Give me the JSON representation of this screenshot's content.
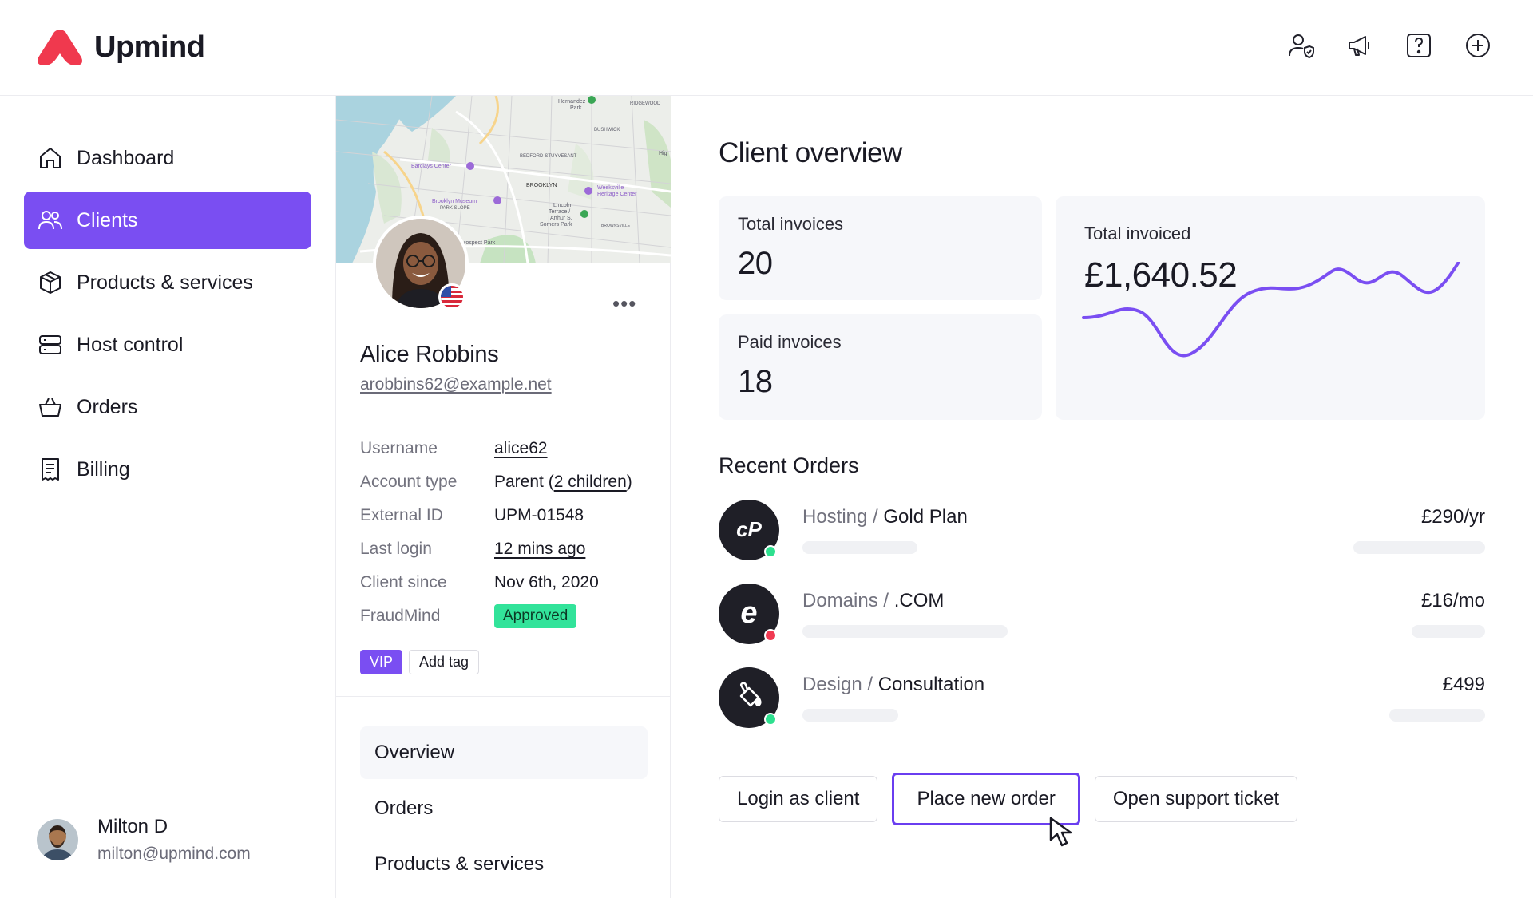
{
  "brand": {
    "name": "Upmind",
    "accent": "#7a4ef2",
    "logo_color": "#f0394e"
  },
  "header": {
    "icons": [
      "user-shield-icon",
      "megaphone-icon",
      "help-icon",
      "plus-circle-icon"
    ]
  },
  "sidebar": {
    "items": [
      {
        "label": "Dashboard",
        "icon": "home-icon",
        "active": false
      },
      {
        "label": "Clients",
        "icon": "users-icon",
        "active": true
      },
      {
        "label": "Products & services",
        "icon": "box-icon",
        "active": false
      },
      {
        "label": "Host control",
        "icon": "server-icon",
        "active": false
      },
      {
        "label": "Orders",
        "icon": "basket-icon",
        "active": false
      },
      {
        "label": "Billing",
        "icon": "receipt-icon",
        "active": false
      }
    ],
    "user": {
      "name": "Milton D",
      "email": "milton@upmind.com"
    }
  },
  "client": {
    "name": "Alice Robbins",
    "email": "arobbins62@example.net",
    "more_label": "•••",
    "details": {
      "username": {
        "label": "Username",
        "value": "alice62"
      },
      "account_type": {
        "label": "Account type",
        "value_prefix": "Parent (",
        "value_link": "2 children",
        "value_suffix": ")"
      },
      "external_id": {
        "label": "External ID",
        "value": "UPM-01548"
      },
      "last_login": {
        "label": "Last login",
        "value": "12 mins ago"
      },
      "client_since": {
        "label": "Client since",
        "value": "Nov 6th, 2020"
      },
      "fraudmind": {
        "label": "FraudMind",
        "value": "Approved"
      }
    },
    "tags": {
      "vip": "VIP",
      "add": "Add tag"
    },
    "subnav": [
      "Overview",
      "Orders",
      "Products & services"
    ],
    "map_labels": {
      "l1": "Hernandez",
      "l2": "Park",
      "l3": "RIDGEWOOD",
      "l4": "BUSHWICK",
      "l5": "BEDFORD-STUYVESANT",
      "l6": "Barclays Center",
      "l7": "BROOKLYN",
      "l8": "Weeksville",
      "l9": "Heritage Center",
      "l10": "Brooklyn Museum",
      "l11": "PARK SLOPE",
      "l12": "Lincoln",
      "l13": "Terrace /",
      "l14": "Arthur S.",
      "l15": "Somers Park",
      "l16": "BROWNSVILLE",
      "l17": "rospect Park",
      "l18": "Hig"
    }
  },
  "overview": {
    "title": "Client overview",
    "total_invoices": {
      "label": "Total invoices",
      "value": "20"
    },
    "paid_invoices": {
      "label": "Paid invoices",
      "value": "18"
    },
    "total_invoiced": {
      "label": "Total invoiced",
      "value": "£1,640.52"
    },
    "recent_orders_title": "Recent Orders",
    "orders": [
      {
        "category": "Hosting /",
        "name": "Gold Plan",
        "price": "£290/yr",
        "icon": "cpanel-icon",
        "status_color": "#2ee08f"
      },
      {
        "category": "Domains /",
        "name": ".COM",
        "price": "£16/mo",
        "icon": "enom-icon",
        "status_color": "#f03a52"
      },
      {
        "category": "Design /",
        "name": "Consultation",
        "price": "£499",
        "icon": "paint-bucket-icon",
        "status_color": "#2ee08f"
      }
    ],
    "buttons": {
      "login": "Login as client",
      "place_order": "Place new order",
      "support": "Open support ticket"
    }
  }
}
